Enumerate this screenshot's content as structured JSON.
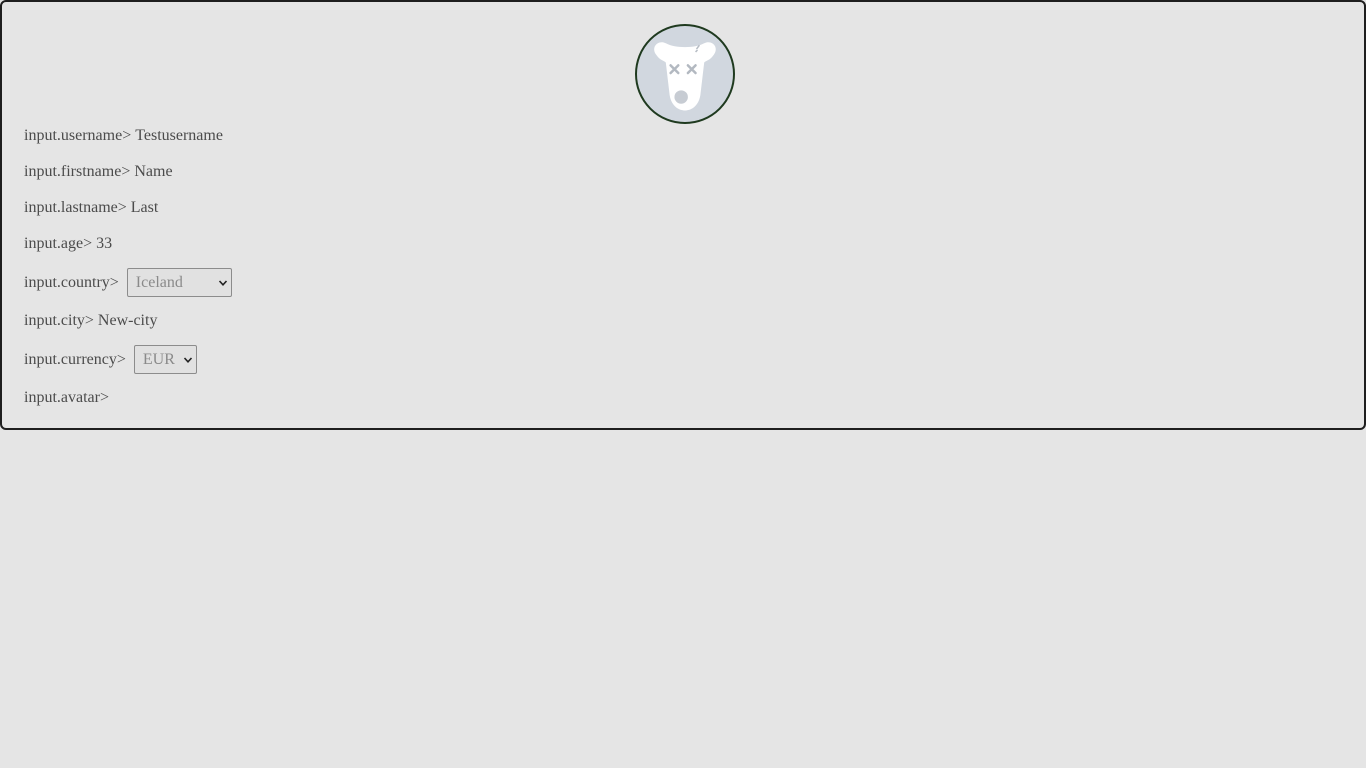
{
  "profile": {
    "avatar_icon": "dead-dog-icon",
    "fields": {
      "username": {
        "label": "input.username>",
        "value": "Testusername"
      },
      "firstname": {
        "label": "input.firstname>",
        "value": "Name"
      },
      "lastname": {
        "label": "input.lastname>",
        "value": "Last"
      },
      "age": {
        "label": "input.age>",
        "value": "33"
      },
      "country": {
        "label": "input.country>",
        "selected": "Iceland"
      },
      "city": {
        "label": "input.city>",
        "value": "New-city"
      },
      "currency": {
        "label": "input.currency>",
        "selected": "EUR"
      },
      "avatar": {
        "label": "input.avatar>"
      }
    }
  },
  "colors": {
    "background": "#e5e5e5",
    "panel_border": "#1e1e1e",
    "avatar_bg": "#d1d7df",
    "avatar_border": "#1f3a1f",
    "text": "#4b4b4b"
  }
}
